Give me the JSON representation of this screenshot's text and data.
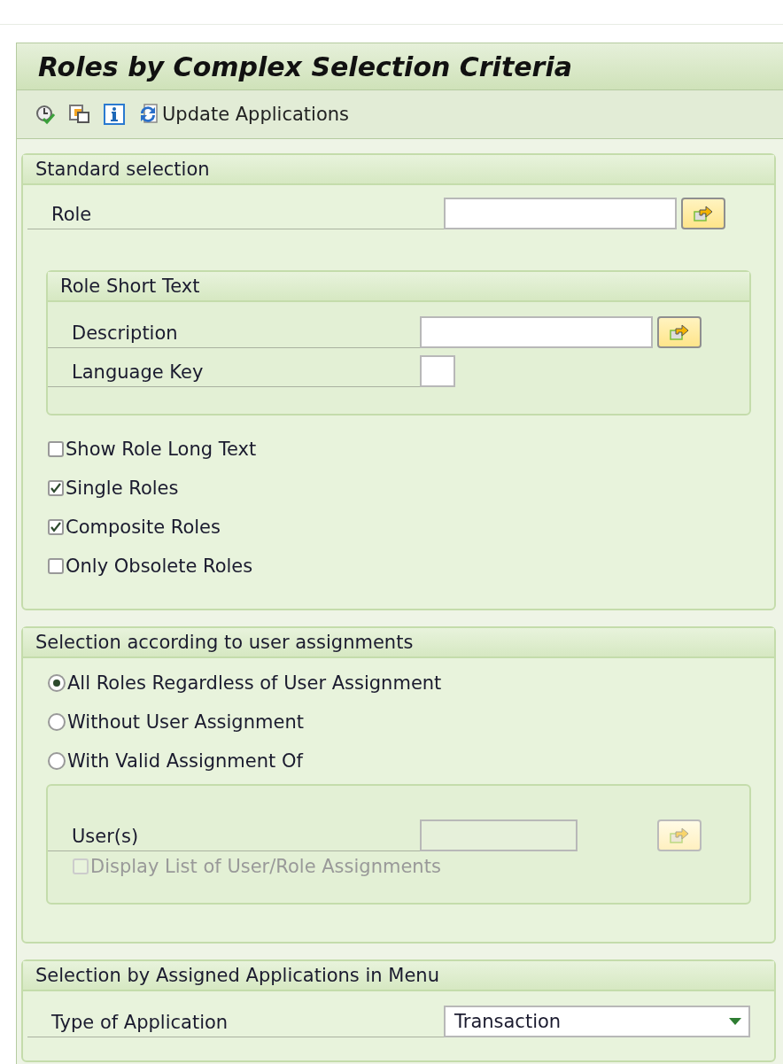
{
  "title": "Roles by Complex Selection Criteria",
  "toolbar": [
    {
      "kind": "execute"
    },
    {
      "kind": "copy"
    },
    {
      "kind": "info"
    },
    {
      "kind": "update",
      "label": "Update Applications"
    }
  ],
  "sections": [
    {
      "title": "Standard selection",
      "rows": [
        {
          "kind": "field",
          "label": "Role",
          "disabled": false
        },
        {
          "kind": "group",
          "title": "Role Short Text",
          "rows": [
            {
              "kind": "field",
              "label": "Description",
              "disabled": false
            },
            {
              "kind": "key_field",
              "label": "Language Key",
              "disabled": false
            }
          ]
        },
        {
          "kind": "checkbox",
          "label": "Show Role Long Text",
          "checked": false,
          "disabled": false
        },
        {
          "kind": "checkbox",
          "label": "Single Roles",
          "checked": true,
          "disabled": false
        },
        {
          "kind": "checkbox",
          "label": "Composite Roles",
          "checked": true,
          "disabled": false
        },
        {
          "kind": "checkbox",
          "label": "Only Obsolete Roles",
          "checked": false,
          "disabled": false
        }
      ]
    },
    {
      "title": "Selection according to user assignments",
      "rows": [
        {
          "kind": "radio",
          "label": "All Roles Regardless of User Assignment",
          "selected": true
        },
        {
          "kind": "radio",
          "label": "Without User Assignment",
          "selected": false
        },
        {
          "kind": "radio",
          "label": "With Valid Assignment Of",
          "selected": false
        },
        {
          "kind": "group",
          "rows": [
            {
              "kind": "field",
              "label": "User(s)",
              "disabled": true
            },
            {
              "kind": "checkbox",
              "label": "Display List of User/Role Assignments",
              "checked": false,
              "disabled": true
            }
          ]
        }
      ]
    },
    {
      "title": "Selection by Assigned Applications in Menu",
      "rows": [
        {
          "kind": "dropdown",
          "label": "Type of Application",
          "value": "Transaction"
        }
      ]
    }
  ]
}
